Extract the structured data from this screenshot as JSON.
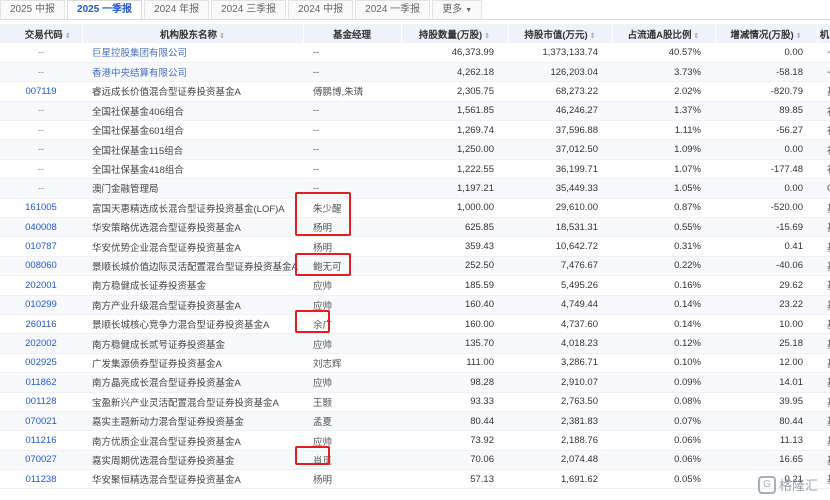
{
  "tabs": [
    {
      "label": "2025 中报",
      "active": false
    },
    {
      "label": "2025 一季报",
      "active": true
    },
    {
      "label": "2024 年报",
      "active": false
    },
    {
      "label": "2024 三季报",
      "active": false
    },
    {
      "label": "2024 中报",
      "active": false
    },
    {
      "label": "2024 一季报",
      "active": false
    },
    {
      "label": "更多",
      "active": false
    }
  ],
  "columns": [
    "交易代码",
    "机构股东名称",
    "基金经理",
    "持股数量(万股)",
    "持股市值(万元)",
    "占流通A股比例",
    "增减情况(万股)",
    "机"
  ],
  "rows": [
    {
      "code": "--",
      "name": "巨星控股集团有限公司",
      "manager": "--",
      "shares": "46,373.99",
      "value": "1,373,133.74",
      "ratio": "40.57%",
      "change": "0.00",
      "tail": "一"
    },
    {
      "code": "--",
      "name": "香港中央结算有限公司",
      "manager": "--",
      "shares": "4,262.18",
      "value": "126,203.04",
      "ratio": "3.73%",
      "change": "-58.18",
      "tail": "一"
    },
    {
      "code": "007119",
      "name": "睿远成长价值混合型证券投资基金A",
      "manager": "傅鹏博,朱璘",
      "shares": "2,305.75",
      "value": "68,273.22",
      "ratio": "2.02%",
      "change": "-820.79",
      "tail": "基"
    },
    {
      "code": "--",
      "name": "全国社保基金406组合",
      "manager": "--",
      "shares": "1,561.85",
      "value": "46,246.27",
      "ratio": "1.37%",
      "change": "89.85",
      "tail": "社"
    },
    {
      "code": "--",
      "name": "全国社保基金601组合",
      "manager": "--",
      "shares": "1,269.74",
      "value": "37,596.88",
      "ratio": "1.11%",
      "change": "-56.27",
      "tail": "社"
    },
    {
      "code": "--",
      "name": "全国社保基金115组合",
      "manager": "--",
      "shares": "1,250.00",
      "value": "37,012.50",
      "ratio": "1.09%",
      "change": "0.00",
      "tail": "社"
    },
    {
      "code": "--",
      "name": "全国社保基金418组合",
      "manager": "--",
      "shares": "1,222.55",
      "value": "36,199.71",
      "ratio": "1.07%",
      "change": "-177.48",
      "tail": "社"
    },
    {
      "code": "--",
      "name": "澳门金融管理局",
      "manager": "--",
      "shares": "1,197.21",
      "value": "35,449.33",
      "ratio": "1.05%",
      "change": "0.00",
      "tail": "QI"
    },
    {
      "code": "161005",
      "name": "富国天惠精选成长混合型证券投资基金(LOF)A",
      "manager": "朱少醒",
      "shares": "1,000.00",
      "value": "29,610.00",
      "ratio": "0.87%",
      "change": "-520.00",
      "tail": "基"
    },
    {
      "code": "040008",
      "name": "华安策略优选混合型证券投资基金A",
      "manager": "杨明",
      "shares": "625.85",
      "value": "18,531.31",
      "ratio": "0.55%",
      "change": "-15.69",
      "tail": "基"
    },
    {
      "code": "010787",
      "name": "华安优势企业混合型证券投资基金A",
      "manager": "杨明",
      "shares": "359.43",
      "value": "10,642.72",
      "ratio": "0.31%",
      "change": "0.41",
      "tail": "基"
    },
    {
      "code": "008060",
      "name": "景顺长城价值边际灵活配置混合型证券投资基金A",
      "manager": "鲍无可",
      "shares": "252.50",
      "value": "7,476.67",
      "ratio": "0.22%",
      "change": "-40.06",
      "tail": "基"
    },
    {
      "code": "202001",
      "name": "南方稳健成长证券投资基金",
      "manager": "应帅",
      "shares": "185.59",
      "value": "5,495.26",
      "ratio": "0.16%",
      "change": "29.62",
      "tail": "基"
    },
    {
      "code": "010299",
      "name": "南方产业升级混合型证券投资基金A",
      "manager": "应帅",
      "shares": "160.40",
      "value": "4,749.44",
      "ratio": "0.14%",
      "change": "23.22",
      "tail": "基"
    },
    {
      "code": "260116",
      "name": "景顺长城核心竞争力混合型证券投资基金A",
      "manager": "余广",
      "shares": "160.00",
      "value": "4,737.60",
      "ratio": "0.14%",
      "change": "10.00",
      "tail": "基"
    },
    {
      "code": "202002",
      "name": "南方稳健成长贰号证券投资基金",
      "manager": "应帅",
      "shares": "135.70",
      "value": "4,018.23",
      "ratio": "0.12%",
      "change": "25.18",
      "tail": "基"
    },
    {
      "code": "002925",
      "name": "广发集源债券型证券投资基金A",
      "manager": "刘志辉",
      "shares": "111.00",
      "value": "3,286.71",
      "ratio": "0.10%",
      "change": "12.00",
      "tail": "基"
    },
    {
      "code": "011862",
      "name": "南方晶亮成长混合型证券投资基金A",
      "manager": "应帅",
      "shares": "98.28",
      "value": "2,910.07",
      "ratio": "0.09%",
      "change": "14.01",
      "tail": "基"
    },
    {
      "code": "001128",
      "name": "宝盈新兴产业灵活配置混合型证券投资基金A",
      "manager": "王颢",
      "shares": "93.33",
      "value": "2,763.50",
      "ratio": "0.08%",
      "change": "39.95",
      "tail": "基"
    },
    {
      "code": "070021",
      "name": "嘉实主题新动力混合型证券投资基金",
      "manager": "孟夏",
      "shares": "80.44",
      "value": "2,381.83",
      "ratio": "0.07%",
      "change": "80.44",
      "tail": "基"
    },
    {
      "code": "011216",
      "name": "南方优质企业混合型证券投资基金A",
      "manager": "应帅",
      "shares": "73.92",
      "value": "2,188.76",
      "ratio": "0.06%",
      "change": "11.13",
      "tail": "基"
    },
    {
      "code": "070027",
      "name": "嘉实周期优选混合型证券投资基金",
      "manager": "肖觅",
      "shares": "70.06",
      "value": "2,074.48",
      "ratio": "0.06%",
      "change": "16.65",
      "tail": "基"
    },
    {
      "code": "011238",
      "name": "华安聚恒精选混合型证券投资基金A",
      "manager": "杨明",
      "shares": "57.13",
      "value": "1,691.62",
      "ratio": "0.05%",
      "change": "0.21",
      "tail": "基"
    }
  ],
  "colors": {
    "accent": "#2457d6",
    "header_bg": "#eef3fb",
    "highlight_box": "#e02020"
  },
  "watermark": "格隆汇"
}
